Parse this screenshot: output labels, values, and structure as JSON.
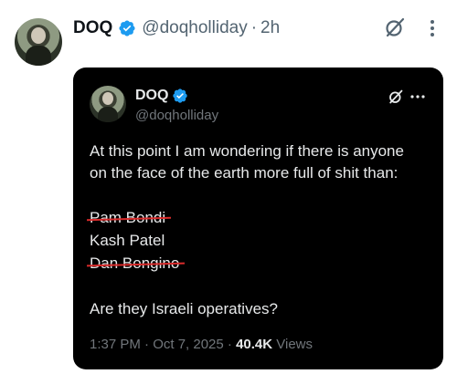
{
  "post": {
    "author_name": "DOQ",
    "handle": "@doqholliday",
    "separator": "·",
    "time": "2h",
    "icons": {
      "verified": "verified-badge-icon",
      "grok": "grok-icon",
      "more": "more-icon"
    }
  },
  "quote": {
    "author_name": "DOQ",
    "handle": "@doqholliday",
    "text_line_1": "At this point I am wondering if there is anyone",
    "text_line_2": "on the face of the earth more full of shit than:",
    "names": [
      {
        "label": "Pam Bondi",
        "struck": true
      },
      {
        "label": "Kash Patel",
        "struck": false
      },
      {
        "label": "Dan Bongino",
        "struck": true
      }
    ],
    "question": "Are they Israeli operatives?",
    "timestamp": "1:37 PM · Oct 7, 2025 · ",
    "views_count": "40.4K",
    "views_label": " Views",
    "strike_color": "#d92b2b"
  },
  "colors": {
    "verified_blue": "#1d9bf0",
    "quote_bg": "#000000",
    "muted_text": "#536471"
  }
}
